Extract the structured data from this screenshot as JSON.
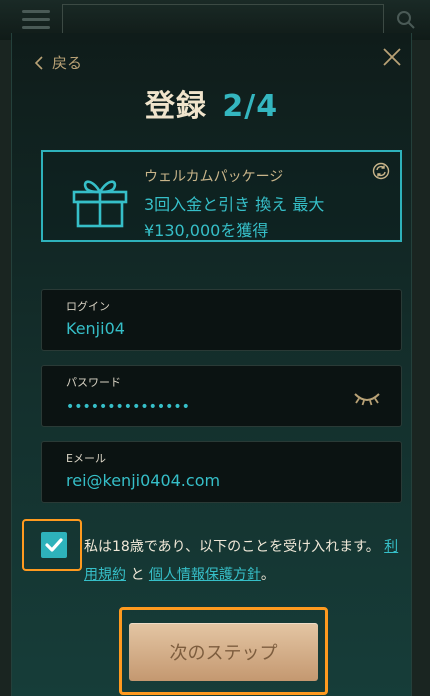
{
  "header": {
    "back_label": "戻る",
    "title": "登録",
    "step": "2/4"
  },
  "promo": {
    "subtitle": "ウェルカムパッケージ",
    "line1": "3回入金と引き 換え 最大",
    "line2": "¥130,000を獲得",
    "icon": "gift-icon"
  },
  "form": {
    "login": {
      "label": "ログイン",
      "value": "Kenji04"
    },
    "password": {
      "label": "パスワード",
      "value": "•••••••••••••••"
    },
    "email": {
      "label": "Eメール",
      "value": "rei@kenji0404.com"
    }
  },
  "terms": {
    "checked": true,
    "text1": "私は18歳であり、以下のことを受け入れます。",
    "link1": "利用規約",
    "and": " と ",
    "link2": "個人情報保護方針",
    "end": "。"
  },
  "actions": {
    "next_label": "次のステップ"
  },
  "colors": {
    "accent": "#2eb2bb",
    "gold": "#c9b58a",
    "highlight": "#ff9a1f",
    "button": "#d8b692"
  }
}
